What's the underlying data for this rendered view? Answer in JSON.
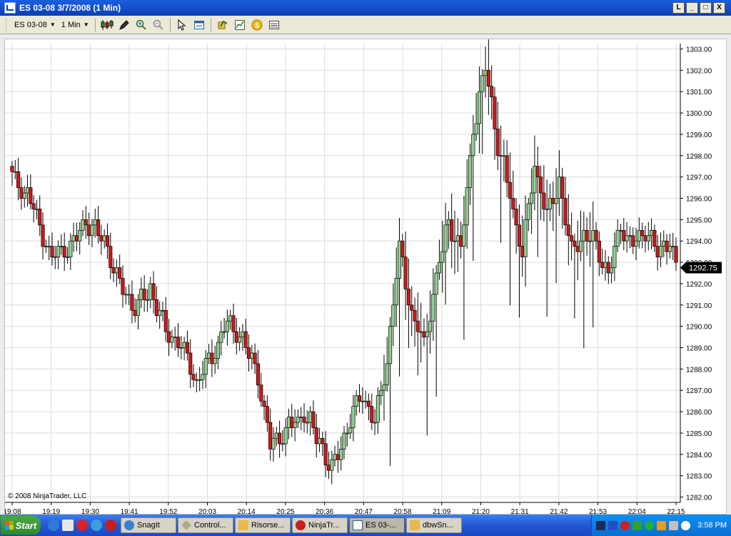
{
  "window": {
    "title": "ES 03-08  3/7/2008 (1 Min)",
    "controls": [
      "L",
      "_",
      "□",
      "X"
    ]
  },
  "toolbar": {
    "instrument": "ES 03-08",
    "interval": "1 Min"
  },
  "chart_data": {
    "type": "candlestick",
    "watermark": "© 2008 NinjaTrader, LLC",
    "last_price_label": "1292.75",
    "ylim": [
      1281.75,
      1303.25
    ],
    "y_ticks": [
      "1282.00",
      "1283.00",
      "1284.00",
      "1285.00",
      "1286.00",
      "1287.00",
      "1288.00",
      "1289.00",
      "1290.00",
      "1291.00",
      "1292.00",
      "1293.00",
      "1294.00",
      "1295.00",
      "1296.00",
      "1297.00",
      "1298.00",
      "1299.00",
      "1300.00",
      "1301.00",
      "1302.00",
      "1303.00"
    ],
    "x_ticks": [
      "19:08",
      "19:19",
      "19:30",
      "19:41",
      "19:52",
      "20:03",
      "20:14",
      "20:25",
      "20:36",
      "20:47",
      "20:58",
      "21:09",
      "21:20",
      "21:31",
      "21:42",
      "21:53",
      "22:04",
      "22:15"
    ],
    "up_color": "#8fd38f",
    "down_color": "#d0181a",
    "grid": true
  },
  "taskbar": {
    "start_label": "Start",
    "tasks": [
      {
        "label": "SnagIt",
        "icon": "snagit-icon",
        "active": false
      },
      {
        "label": "Control...",
        "icon": "control-panel-icon",
        "active": false
      },
      {
        "label": "Risorse...",
        "icon": "folder-icon",
        "active": false
      },
      {
        "label": "NinjaTr...",
        "icon": "ninjatrader-icon",
        "active": false
      },
      {
        "label": "ES 03-...",
        "icon": "chart-icon",
        "active": true
      },
      {
        "label": "dbwSn...",
        "icon": "folder-icon",
        "active": false
      }
    ],
    "clock": "3:58 PM"
  },
  "colors": {
    "titlebar": "#0a3fb3",
    "taskbar": "#2356d3",
    "grid": "#dcdcdc"
  }
}
